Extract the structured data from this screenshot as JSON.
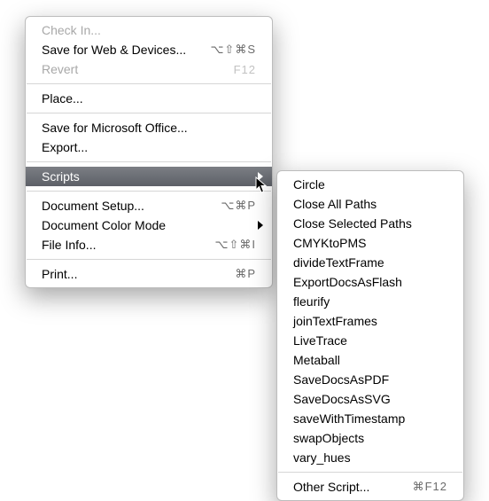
{
  "main_menu": {
    "check_in": "Check In...",
    "save_web": "Save for Web & Devices...",
    "save_web_sc": "⌥⇧⌘S",
    "revert": "Revert",
    "revert_sc": "F12",
    "place": "Place...",
    "save_ms": "Save for Microsoft Office...",
    "export": "Export...",
    "scripts": "Scripts",
    "doc_setup": "Document Setup...",
    "doc_setup_sc": "⌥⌘P",
    "doc_color": "Document Color Mode",
    "file_info": "File Info...",
    "file_info_sc": "⌥⇧⌘I",
    "print": "Print...",
    "print_sc": "⌘P"
  },
  "scripts_menu": {
    "items": [
      "Circle",
      "Close All Paths",
      "Close Selected Paths",
      "CMYKtoPMS",
      "divideTextFrame",
      "ExportDocsAsFlash",
      "fleurify",
      "joinTextFrames",
      "LiveTrace",
      "Metaball",
      "SaveDocsAsPDF",
      "SaveDocsAsSVG",
      "saveWithTimestamp",
      "swapObjects",
      "vary_hues"
    ],
    "other": "Other Script...",
    "other_sc": "⌘F12"
  }
}
